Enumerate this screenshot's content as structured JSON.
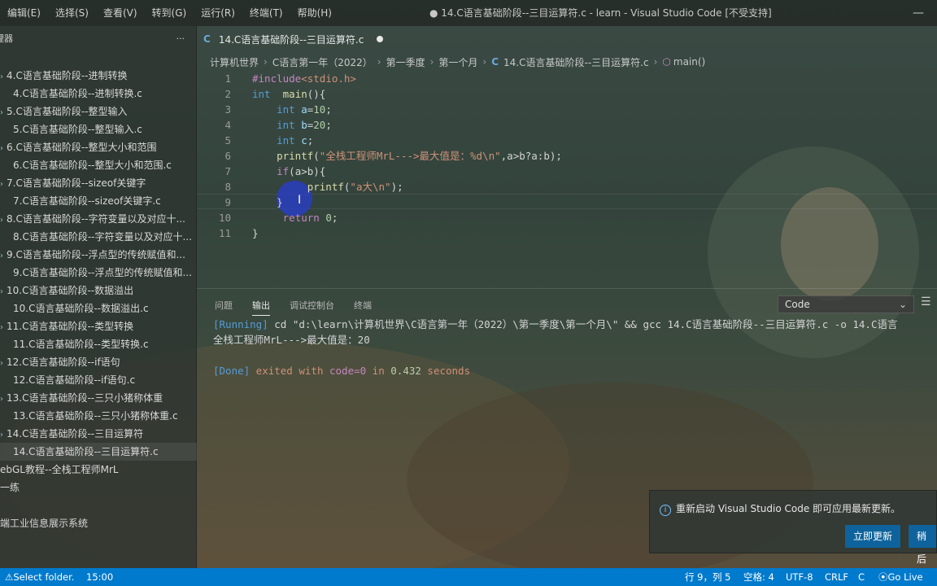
{
  "menu": [
    "编辑(E)",
    "选择(S)",
    "查看(V)",
    "转到(G)",
    "运行(R)",
    "终端(T)",
    "帮助(H)"
  ],
  "window_title": "● 14.C语言基础阶段--三目运算符.c - learn - Visual Studio Code [不受支持]",
  "sidebar": {
    "title": "理器",
    "more": "···",
    "items": [
      {
        "label": "4.C语言基础阶段--进制转换",
        "icon": "folder"
      },
      {
        "label": "4.C语言基础阶段--进制转换.c",
        "icon": "c-file"
      },
      {
        "label": "5.C语言基础阶段--整型输入",
        "icon": "folder"
      },
      {
        "label": "5.C语言基础阶段--整型输入.c",
        "icon": "c-file"
      },
      {
        "label": "6.C语言基础阶段--整型大小和范围",
        "icon": "folder"
      },
      {
        "label": "6.C语言基础阶段--整型大小和范围.c",
        "icon": "c-file"
      },
      {
        "label": "7.C语言基础阶段--sizeof关键字",
        "icon": "folder"
      },
      {
        "label": "7.C语言基础阶段--sizeof关键字.c",
        "icon": "c-file"
      },
      {
        "label": "8.C语言基础阶段--字符变量以及对应十...",
        "icon": "folder"
      },
      {
        "label": "8.C语言基础阶段--字符变量以及对应十...",
        "icon": "c-file"
      },
      {
        "label": "9.C语言基础阶段--浮点型的传统赋值和...",
        "icon": "folder"
      },
      {
        "label": "9.C语言基础阶段--浮点型的传统赋值和...",
        "icon": "c-file"
      },
      {
        "label": "10.C语言基础阶段--数据溢出",
        "icon": "folder"
      },
      {
        "label": "10.C语言基础阶段--数据溢出.c",
        "icon": "c-file"
      },
      {
        "label": "11.C语言基础阶段--类型转换",
        "icon": "folder"
      },
      {
        "label": "11.C语言基础阶段--类型转换.c",
        "icon": "c-file"
      },
      {
        "label": "12.C语言基础阶段--if语句",
        "icon": "folder"
      },
      {
        "label": "12.C语言基础阶段--if语句.c",
        "icon": "c-file"
      },
      {
        "label": "13.C语言基础阶段--三只小猪称体重",
        "icon": "folder"
      },
      {
        "label": "13.C语言基础阶段--三只小猪称体重.c",
        "icon": "c-file"
      },
      {
        "label": "14.C语言基础阶段--三目运算符",
        "icon": "folder"
      },
      {
        "label": "14.C语言基础阶段--三目运算符.c",
        "icon": "c-file",
        "selected": true
      }
    ],
    "extra_items": [
      "ebGL教程--全栈工程师MrL",
      "一练",
      "端工业信息展示系统"
    ]
  },
  "tab": {
    "icon": "C",
    "label": "14.C语言基础阶段--三目运算符.c",
    "modified": true
  },
  "breadcrumb": [
    "计算机世界",
    "C语言第一年（2022）",
    "第一季度",
    "第一个月",
    "14.C语言基础阶段--三目运算符.c",
    "main()"
  ],
  "code_lines": [
    {
      "n": "1",
      "tokens": [
        [
          "pp",
          "#include"
        ],
        [
          "str",
          "<stdio.h>"
        ]
      ]
    },
    {
      "n": "2",
      "tokens": [
        [
          "kw",
          "int"
        ],
        [
          "",
          "  "
        ],
        [
          "fn",
          "main"
        ],
        [
          "",
          "(){"
        ]
      ]
    },
    {
      "n": "3",
      "tokens": [
        [
          "",
          "    "
        ],
        [
          "kw",
          "int"
        ],
        [
          "var",
          " a"
        ],
        [
          "",
          "="
        ],
        [
          "num",
          "10"
        ],
        [
          "",
          ";"
        ]
      ]
    },
    {
      "n": "4",
      "tokens": [
        [
          "",
          "    "
        ],
        [
          "kw",
          "int"
        ],
        [
          "var",
          " b"
        ],
        [
          "",
          "="
        ],
        [
          "num",
          "20"
        ],
        [
          "",
          ";"
        ]
      ]
    },
    {
      "n": "5",
      "tokens": [
        [
          "",
          "    "
        ],
        [
          "kw",
          "int"
        ],
        [
          "var",
          " c"
        ],
        [
          "",
          ";"
        ]
      ]
    },
    {
      "n": "6",
      "tokens": [
        [
          "",
          "    "
        ],
        [
          "fn",
          "printf"
        ],
        [
          "",
          "("
        ],
        [
          "str",
          "\"全栈工程师MrL--->最大值是：%d\\n\""
        ],
        [
          "",
          ",a>b?a:b);"
        ]
      ]
    },
    {
      "n": "7",
      "tokens": [
        [
          "",
          "    "
        ],
        [
          "pp",
          "if"
        ],
        [
          "",
          "(a>b){"
        ]
      ]
    },
    {
      "n": "8",
      "tokens": [
        [
          "",
          "         "
        ],
        [
          "fn",
          "printf"
        ],
        [
          "",
          "("
        ],
        [
          "str",
          "\"a大\\n\""
        ],
        [
          "",
          ");"
        ]
      ]
    },
    {
      "n": "9",
      "tokens": [
        [
          "",
          "    }"
        ]
      ]
    },
    {
      "n": "10",
      "tokens": [
        [
          "",
          "     "
        ],
        [
          "pp",
          "return"
        ],
        [
          "num",
          " 0"
        ],
        [
          "",
          ";"
        ]
      ]
    },
    {
      "n": "11",
      "tokens": [
        [
          "",
          "}"
        ]
      ]
    }
  ],
  "panel": {
    "tabs": [
      "问题",
      "输出",
      "调试控制台",
      "终端"
    ],
    "active_tab": "输出",
    "select_value": "Code",
    "output": {
      "running_tag": "[Running]",
      "running_cmd": " cd \"d:\\learn\\计算机世界\\C语言第一年（2022）\\第一季度\\第一个月\\\" && gcc 14.C语言基础阶段--三目运算符.c -o 14.C语言",
      "result": "全栈工程师MrL--->最大值是：20",
      "done_tag": "[Done]",
      "done_text": " exited with ",
      "done_code": "code=0",
      "done_in": " in ",
      "done_secs": "0.432",
      "done_unit": " seconds"
    }
  },
  "notification": {
    "message": "重新启动 Visual Studio Code 即可应用最新更新。",
    "primary_button": "立即更新",
    "secondary_button": "稍后"
  },
  "status": {
    "left_action": "Select folder.",
    "time": "15:00",
    "position": "行 9，列 5",
    "spaces": "空格: 4",
    "encoding": "UTF-8",
    "eol": "CRLF",
    "language": "C",
    "golive": "Go Live"
  }
}
